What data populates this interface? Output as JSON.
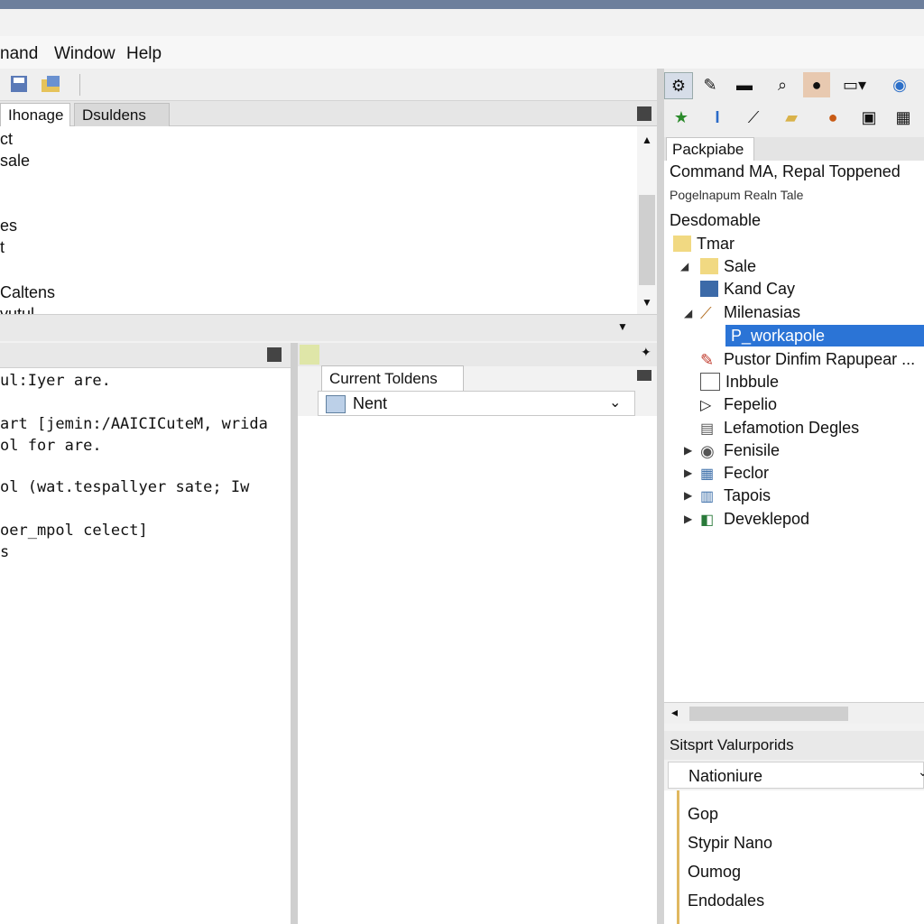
{
  "menubar": {
    "command": "nand",
    "window": "Window",
    "help": "Help"
  },
  "toolbar_left": {
    "icons": [
      "save-icon",
      "open-icon"
    ]
  },
  "editor": {
    "tab_active": "Ihonage",
    "tab_inactive": "Dsuldens",
    "lines": [
      "ct",
      "sale",
      "",
      "es",
      "t",
      "Caltens",
      "vutul"
    ]
  },
  "command_window": {
    "lines": [
      "ul:Iyer are.",
      "",
      "art [jemin:/AAICICuteM, wrida",
      "ol for are.",
      "",
      "ol (wat.tespallyer sate; Iw",
      "",
      "oer_mpol celect]",
      "s"
    ]
  },
  "current_folder": {
    "tab": "Current Toldens",
    "selected": "Nent"
  },
  "right_panel": {
    "tab": "Packpiabe",
    "header": "Command MA, Repal Toppened",
    "subheader": "Pogelnapum Realn Tale",
    "section": "Desdomable",
    "tree": [
      {
        "label": "Tmar"
      },
      {
        "label": "Sale"
      },
      {
        "label": "Kand Cay"
      },
      {
        "label": "Milenasias"
      },
      {
        "label": "P_workapole"
      },
      {
        "label": "Pustor Dinfim Rapupear ..."
      },
      {
        "label": "Inbbule"
      },
      {
        "label": "Fepelio"
      },
      {
        "label": "Lefamotion Degles"
      },
      {
        "label": "Fenisile"
      },
      {
        "label": "Feclor"
      },
      {
        "label": "Tapois"
      },
      {
        "label": "Deveklepod"
      }
    ]
  },
  "lower_panel": {
    "title": "Sitsprt Valurporids",
    "selected": "Nationiure",
    "items": [
      "Gop",
      "Stypir Nano",
      "Oumog",
      "Endodales"
    ]
  }
}
